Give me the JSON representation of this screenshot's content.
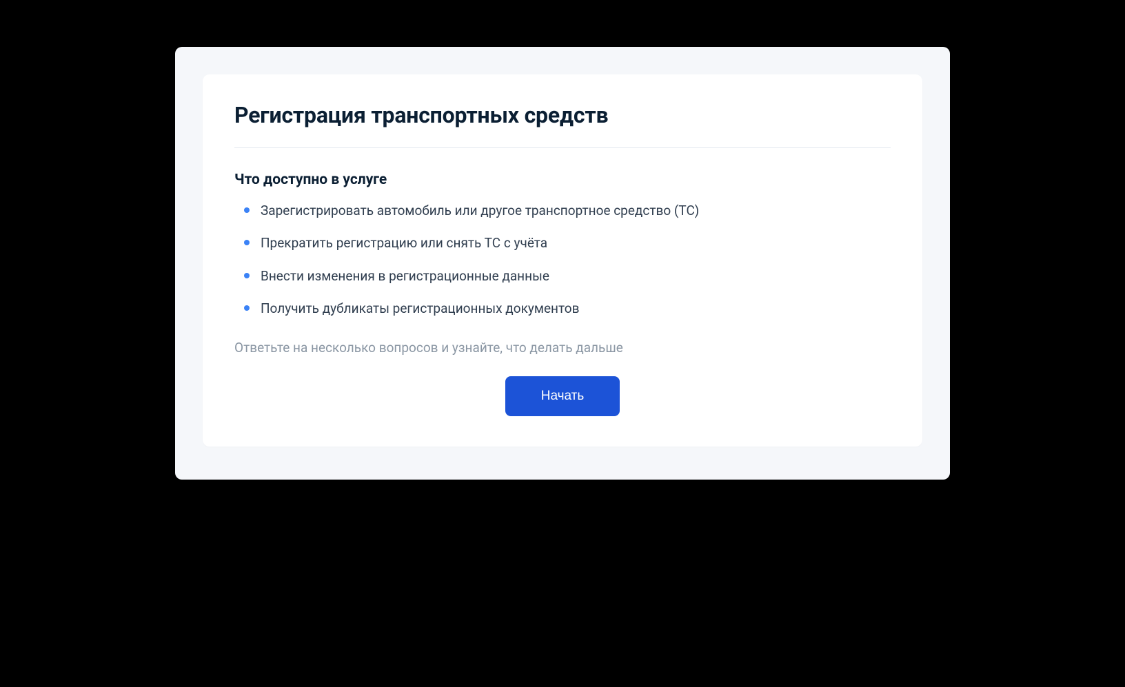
{
  "card": {
    "title": "Регистрация транспортных средств",
    "subtitle": "Что доступно в услуге",
    "bullets": [
      "Зарегистрировать автомобиль или другое транспортное средство (ТС)",
      "Прекратить регистрацию или снять ТС с учёта",
      "Внести изменения в регистрационные данные",
      "Получить дубликаты регистрационных документов"
    ],
    "hint": "Ответьте на несколько вопросов и узнайте, что делать дальше",
    "action_label": "Начать"
  }
}
